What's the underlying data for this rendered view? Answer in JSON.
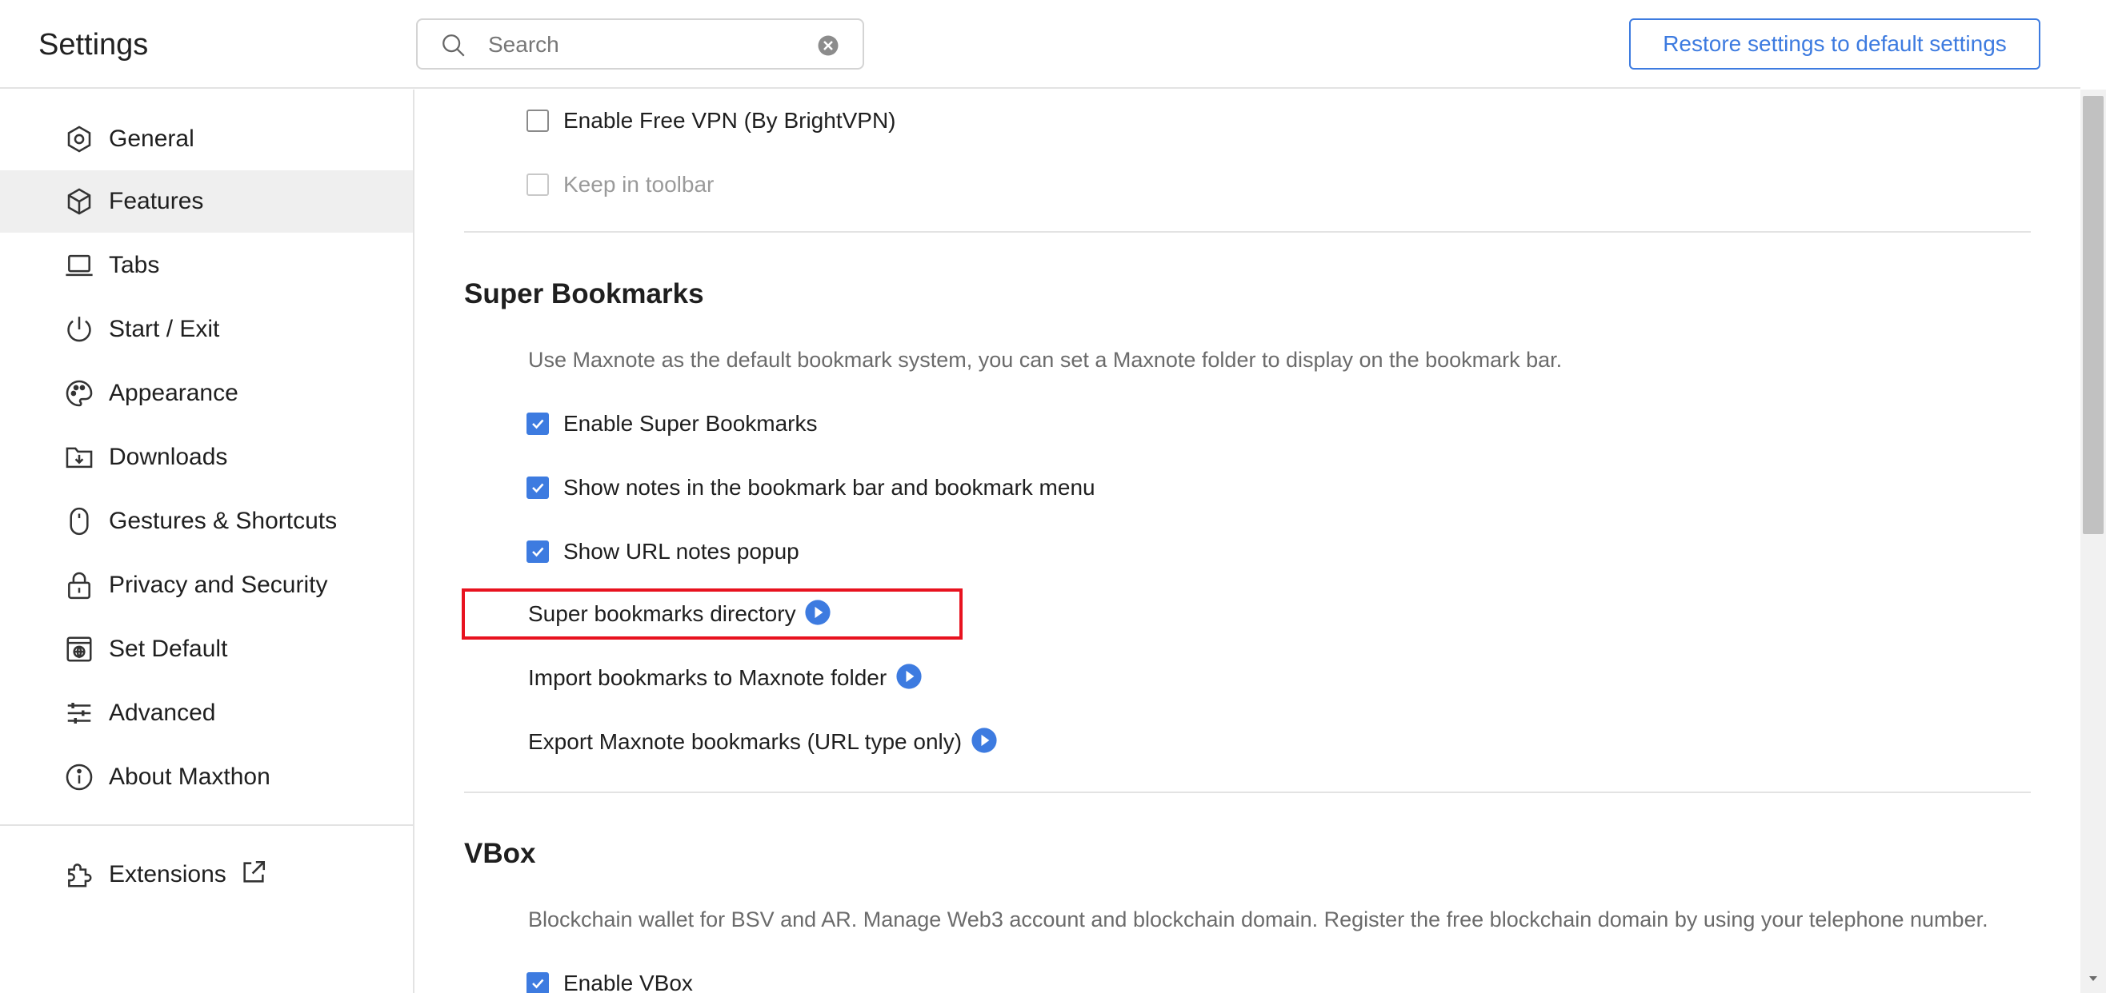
{
  "header": {
    "title": "Settings",
    "search_placeholder": "Search",
    "search_value": "",
    "restore_button_label": "Restore settings to default settings"
  },
  "sidebar": {
    "items": [
      {
        "label": "General",
        "icon": "gear-icon",
        "active": false
      },
      {
        "label": "Features",
        "icon": "cube-icon",
        "active": true
      },
      {
        "label": "Tabs",
        "icon": "laptop-icon",
        "active": false
      },
      {
        "label": "Start / Exit",
        "icon": "power-icon",
        "active": false
      },
      {
        "label": "Appearance",
        "icon": "palette-icon",
        "active": false
      },
      {
        "label": "Downloads",
        "icon": "download-folder-icon",
        "active": false
      },
      {
        "label": "Gestures & Shortcuts",
        "icon": "mouse-icon",
        "active": false
      },
      {
        "label": "Privacy and Security",
        "icon": "lock-icon",
        "active": false
      },
      {
        "label": "Set Default",
        "icon": "browser-globe-icon",
        "active": false
      },
      {
        "label": "Advanced",
        "icon": "sliders-icon",
        "active": false
      },
      {
        "label": "About Maxthon",
        "icon": "info-icon",
        "active": false
      }
    ],
    "extensions": {
      "label": "Extensions",
      "icon": "puzzle-icon"
    }
  },
  "vpn": {
    "enable_label": "Enable Free VPN (By BrightVPN)",
    "enable_checked": false,
    "keep_toolbar_label": "Keep in toolbar",
    "keep_toolbar_checked": false,
    "keep_toolbar_disabled": true
  },
  "super_bookmarks": {
    "title": "Super Bookmarks",
    "description": "Use Maxnote as the default bookmark system, you can set a Maxnote folder to display on the bookmark bar.",
    "options": [
      {
        "label": "Enable Super Bookmarks",
        "checked": true
      },
      {
        "label": "Show notes in the bookmark bar and bookmark menu",
        "checked": true
      },
      {
        "label": "Show URL notes popup",
        "checked": true
      }
    ],
    "links": [
      {
        "label": "Super bookmarks directory"
      },
      {
        "label": "Import bookmarks to Maxnote folder"
      },
      {
        "label": "Export Maxnote bookmarks (URL type only)"
      }
    ]
  },
  "vbox": {
    "title": "VBox",
    "description": "Blockchain wallet for BSV and AR. Manage Web3 account and blockchain domain. Register the free blockchain domain by using your telephone number.",
    "enable_label": "Enable VBox",
    "enable_checked": true
  },
  "colors": {
    "accent": "#3d7be0",
    "highlight": "#e8121f",
    "active_nav_bg": "#efefef"
  }
}
